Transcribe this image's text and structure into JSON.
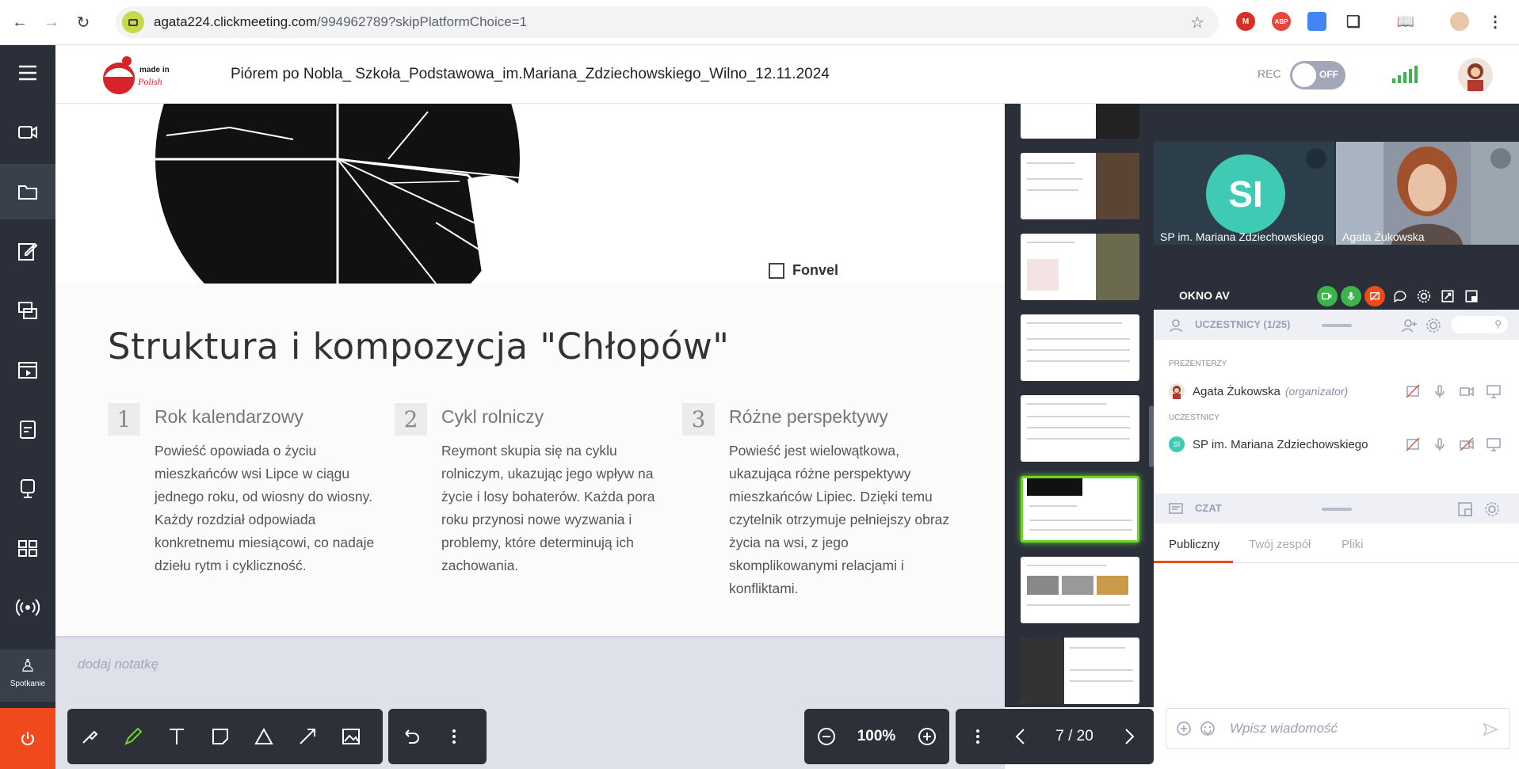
{
  "browser": {
    "url_host": "agata224.clickmeeting.com",
    "url_path": "/994962789?skipPlatformChoice=1",
    "extensions": [
      {
        "name": "gmail-icon",
        "label": "M",
        "color": "#d93025"
      },
      {
        "name": "adblock-icon",
        "label": "ABP",
        "color": "#e8453c"
      },
      {
        "name": "google-ext-icon",
        "label": "",
        "color": "#4285f4"
      }
    ]
  },
  "sidebar": {
    "items": [
      "menu",
      "camera",
      "files",
      "whiteboard",
      "screen-share",
      "video",
      "tests",
      "webinar",
      "apps",
      "broadcast"
    ],
    "meeting_label": "Spotkanie"
  },
  "header": {
    "title": "Piórem po Nobla_ Szkoła_Podstawowa_im.Mariana_Zdziechowskiego_Wilno_12.11.2024",
    "rec_label": "REC",
    "rec_state": "OFF",
    "logo_text": "made in Polish"
  },
  "slide": {
    "checkbox_label": "Fonvel",
    "title": "Struktura i kompozycja \"Chłopów\"",
    "columns": [
      {
        "num": "1",
        "head": "Rok kalendarzowy",
        "body": "Powieść opowiada o życiu mieszkańców wsi Lipce w ciągu jednego roku, od wiosny do wiosny. Każdy rozdział odpowiada konkretnemu miesiącowi, co nadaje dziełu rytm i cykliczność."
      },
      {
        "num": "2",
        "head": "Cykl rolniczy",
        "body": "Reymont skupia się na cyklu rolniczym, ukazując jego wpływ na życie i losy bohaterów. Każda pora roku przynosi nowe wyzwania i problemy, które determinują ich zachowania."
      },
      {
        "num": "3",
        "head": "Różne perspektywy",
        "body": "Powieść jest wielowątkowa, ukazująca różne perspektywy mieszkańców Lipiec. Dzięki temu czytelnik otrzymuje pełniejszy obraz życia na wsi, z jego skomplikowanymi relacjami i konfliktami."
      }
    ]
  },
  "notes": {
    "placeholder": "dodaj notatkę"
  },
  "toolbar": {
    "zoom": "100%",
    "page": "7 / 20"
  },
  "videos": [
    {
      "initials": "SI",
      "name": "SP im. Mariana Zdziechowskiego",
      "color": "#3fcab3"
    },
    {
      "name": "Agata Żukowska"
    }
  ],
  "av_panel": {
    "label": "OKNO AV"
  },
  "participants": {
    "header": "UCZESTNICY (1/25)",
    "presenters_label": "PREZENTERZY",
    "attendees_label": "UCZESTNICY",
    "presenters": [
      {
        "name": "Agata Żukowska",
        "role": "(organizator)"
      }
    ],
    "attendees": [
      {
        "initials": "SI",
        "name": "SP im. Mariana Zdziechowskiego"
      }
    ]
  },
  "chat": {
    "header": "CZAT",
    "tabs": [
      "Publiczny",
      "Twój zespół",
      "Pliki"
    ],
    "active_tab": "Publiczny",
    "placeholder": "Wpisz wiadomość"
  },
  "colors": {
    "accent": "#f04a1c",
    "sidebar": "#2b2f3a",
    "active_thumb": "#6bd62b",
    "signal": "#3cb44b"
  }
}
